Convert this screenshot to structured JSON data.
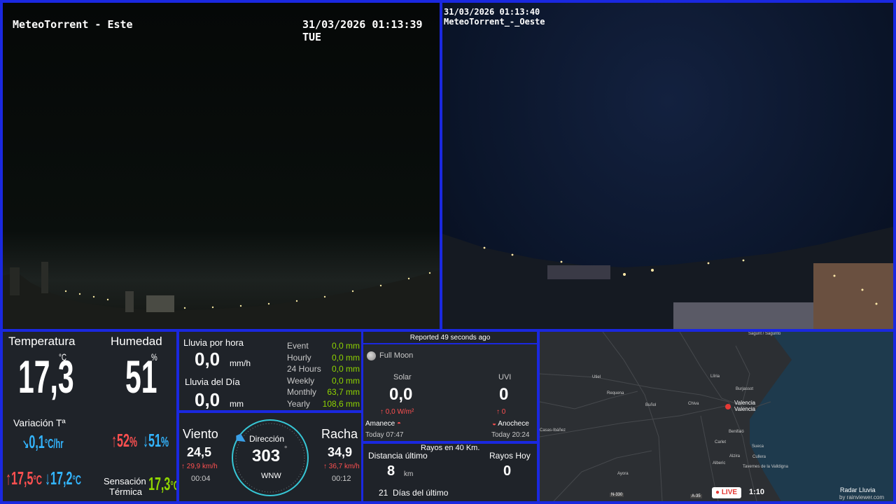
{
  "cam_east": {
    "title": "MeteoTorrent - Este",
    "timestamp": "31/03/2026 01:13:39 TUE"
  },
  "cam_west": {
    "timestamp": "31/03/2026 01:13:40",
    "title": "MeteoTorrent_-_Oeste"
  },
  "temp": {
    "label": "Temperatura",
    "value": "17,3",
    "unit": "°C",
    "var_label": "Variación Tª",
    "var_value": "0,1",
    "var_unit": "°C/hr",
    "max": "17,5",
    "max_unit": "°C",
    "min": "17,2",
    "min_unit": "°C"
  },
  "hum": {
    "label": "Humedad",
    "value": "51",
    "unit": "%",
    "max": "52",
    "min": "51",
    "pct": "%",
    "feels_label1": "Sensación",
    "feels_label2": "Térmica",
    "feels_value": "17,3",
    "feels_unit": "°C"
  },
  "rain": {
    "hour_label": "Lluvia por hora",
    "hour_value": "0,0",
    "hour_unit": "mm/h",
    "day_label": "Lluvia del Día",
    "day_value": "0,0",
    "day_unit": "mm",
    "rows": [
      {
        "label": "Event",
        "value": "0,0 mm"
      },
      {
        "label": "Hourly",
        "value": "0,0 mm"
      },
      {
        "label": "24 Hours",
        "value": "0,0 mm"
      },
      {
        "label": "Weekly",
        "value": "0,0 mm"
      },
      {
        "label": "Monthly",
        "value": "63,7 mm"
      },
      {
        "label": "Yearly",
        "value": "108,6 mm"
      }
    ]
  },
  "wind": {
    "label": "Viento",
    "value": "24,5",
    "max": "29,9 km/h",
    "time": "00:04",
    "dir_label": "Dirección",
    "dir_value": "303",
    "deg": "°",
    "dir_text": "WNW",
    "gust_label": "Racha",
    "gust_value": "34,9",
    "gust_max": "36,7 km/h",
    "gust_time": "00:12",
    "direction_degrees": 303
  },
  "solar": {
    "reported": "Reported 49 seconds ago",
    "moon": "Full Moon",
    "solar_label": "Solar",
    "solar_value": "0,0",
    "solar_max": "0,0 W/m²",
    "uvi_label": "UVI",
    "uvi_value": "0",
    "uvi_max": "0",
    "sunrise_label": "Amanece",
    "sunrise_time": "Today 07:47",
    "sunset_label": "Anochece",
    "sunset_time": "Today 20:24"
  },
  "lightning": {
    "title": "Rayos en 40 Km.",
    "dist_label": "Distancia último",
    "dist_value": "8",
    "dist_unit": "km",
    "today_label": "Rayos Hoy",
    "today_value": "0",
    "days_text": "21  Días del último"
  },
  "map": {
    "places": [
      {
        "name": "Sagunt / Sagunto"
      },
      {
        "name": "Llíria"
      },
      {
        "name": "Burjassot"
      },
      {
        "name": "Valencia"
      },
      {
        "name": "Valencia"
      },
      {
        "name": "Requena"
      },
      {
        "name": "Buñol"
      },
      {
        "name": "Chiva"
      },
      {
        "name": "Utiel"
      },
      {
        "name": "Benifaió"
      },
      {
        "name": "Carlet"
      },
      {
        "name": "Sueca"
      },
      {
        "name": "Alzira"
      },
      {
        "name": "Alberic"
      },
      {
        "name": "Cullera"
      },
      {
        "name": "Tavernes de la Valldigna"
      },
      {
        "name": "Ayora"
      },
      {
        "name": "Casas-Ibáñez"
      }
    ],
    "live": "LIVE",
    "time": "1:10",
    "credit1": "Radar Lluvia",
    "credit2": "by rainviewer.com",
    "road1": "N-330",
    "road2": "A-35"
  },
  "colors": {
    "frame": "#1a28e0",
    "panel": "#1f2329",
    "red": "#ff5050",
    "blue": "#33b5ff",
    "green": "#8fd400"
  }
}
